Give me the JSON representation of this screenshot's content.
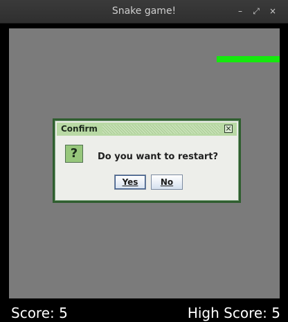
{
  "window": {
    "title": "Snake game!",
    "controls": {
      "minimize": "–",
      "restore": "⤢",
      "close": "×"
    }
  },
  "game": {
    "score_label": "Score: 5",
    "high_score_label": "High Score: 5"
  },
  "dialog": {
    "title": "Confirm",
    "icon_glyph": "?",
    "message": "Do you want to restart?",
    "yes_label": "Yes",
    "no_label": "No"
  },
  "colors": {
    "playfield": "#7b7b7b",
    "snake": "#15e80e",
    "dialog_border": "#2f5e2f",
    "dialog_title_bg": "#b9d9a5"
  },
  "icons": {
    "question": "question-icon",
    "close": "close-icon"
  }
}
